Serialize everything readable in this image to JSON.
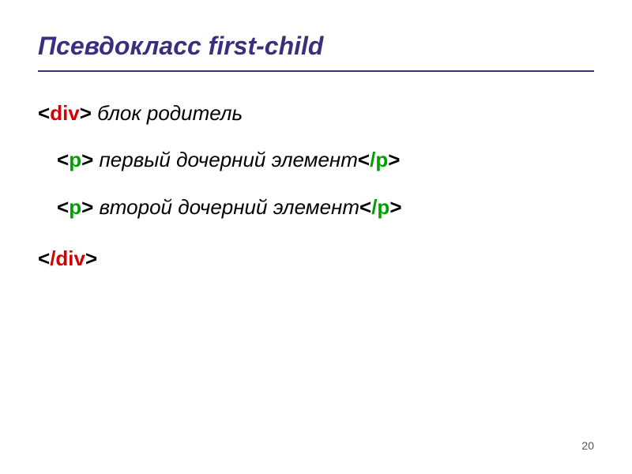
{
  "title": "Псевдокласс first-child",
  "line1": {
    "open_bracket": "<",
    "tag": "div",
    "close_bracket": ">",
    "comment": "  блок родитель"
  },
  "line2": {
    "open_bracket": "<",
    "tag": "p",
    "close_bracket": "> ",
    "comment": "первый дочерний элемент",
    "close_open_bracket": "<",
    "close_slash": "/",
    "close_tag": "p",
    "close_close_bracket": ">"
  },
  "line3": {
    "open_bracket": "<",
    "tag": "p",
    "close_bracket": "> ",
    "comment": "второй дочерний элемент",
    "close_open_bracket": "<",
    "close_slash": "/",
    "close_tag": "p",
    "close_close_bracket": ">"
  },
  "line4": {
    "open_bracket": "<",
    "slash": "/",
    "tag": "div",
    "close_bracket": ">"
  },
  "page_number": "20"
}
